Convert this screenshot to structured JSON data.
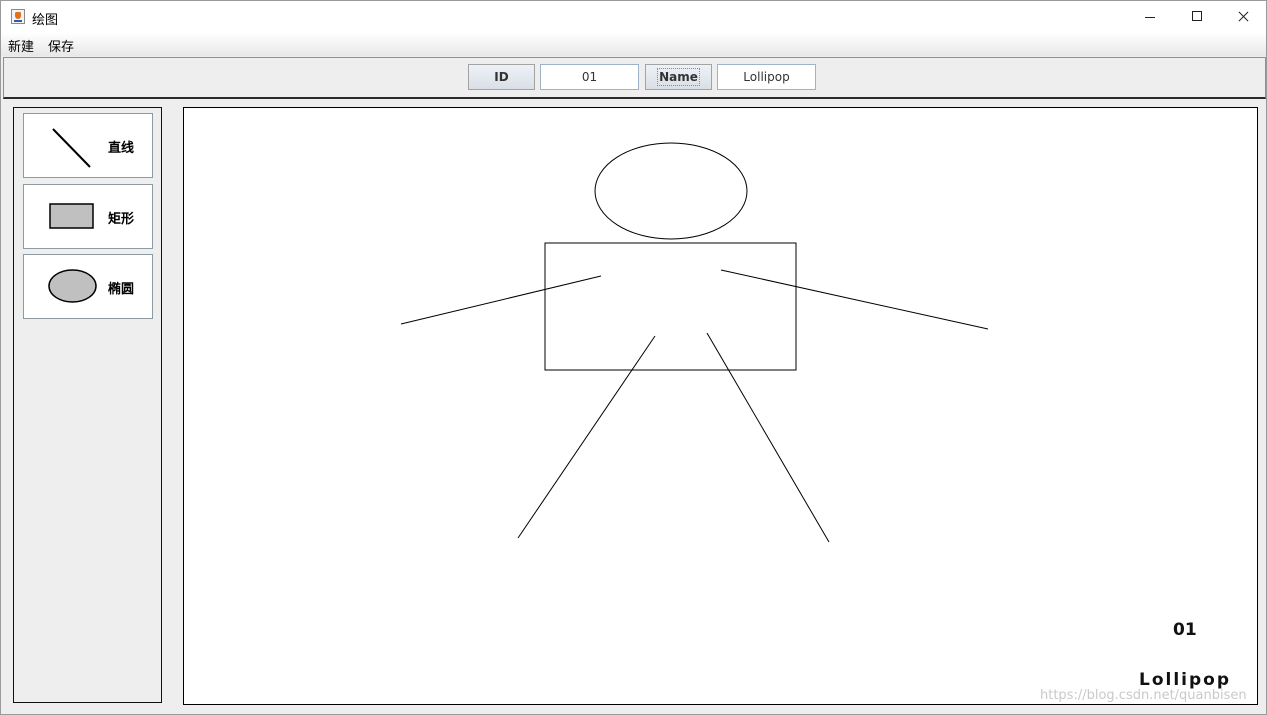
{
  "window": {
    "title": "绘图",
    "icon": "java-app-icon",
    "controls": [
      "minimize-icon",
      "maximize-icon",
      "close-icon"
    ]
  },
  "menubar": {
    "items": [
      {
        "label": "新建"
      },
      {
        "label": "保存"
      }
    ]
  },
  "toolbar": {
    "id_label": "ID",
    "id_value": "01",
    "name_label": "Name",
    "name_value": "Lollipop"
  },
  "tools": [
    {
      "label": "直线",
      "icon": "line-icon"
    },
    {
      "label": "矩形",
      "icon": "rectangle-icon"
    },
    {
      "label": "椭圆",
      "icon": "ellipse-icon"
    }
  ],
  "canvas": {
    "id_text": "01",
    "name_text": "Lollipop",
    "shapes": [
      "ellipse",
      "rectangle",
      "line",
      "line",
      "line",
      "line"
    ]
  },
  "watermark": "https://blog.csdn.net/quanbisen",
  "colors": {
    "tool_icon_fill": "#c0c0c0",
    "canvas_background": "#ffffff",
    "stroke": "#000000"
  }
}
